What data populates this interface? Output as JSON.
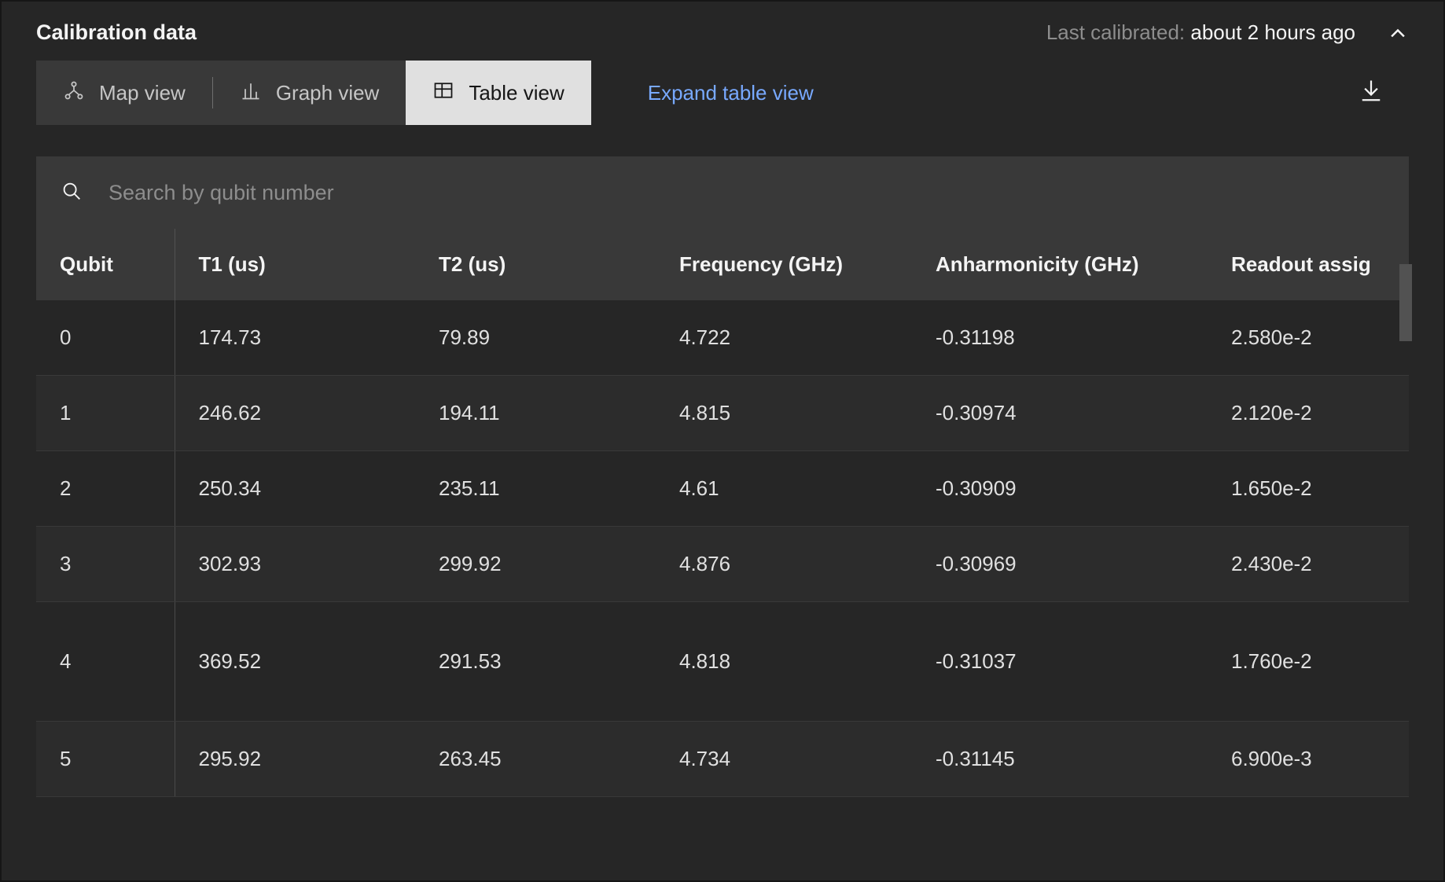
{
  "header": {
    "title": "Calibration data",
    "last_calibrated_label": "Last calibrated: ",
    "last_calibrated_value": "about 2 hours ago"
  },
  "tabs": {
    "map": "Map view",
    "graph": "Graph view",
    "table": "Table view"
  },
  "expand_link": "Expand table view",
  "search": {
    "placeholder": "Search by qubit number"
  },
  "columns": {
    "qubit": "Qubit",
    "t1": "T1 (us)",
    "t2": "T2 (us)",
    "freq": "Frequency (GHz)",
    "anh": "Anharmonicity (GHz)",
    "ro": "Readout assig"
  },
  "rows": [
    {
      "qubit": "0",
      "t1": "174.73",
      "t2": "79.89",
      "freq": "4.722",
      "anh": "-0.31198",
      "ro": "2.580e-2"
    },
    {
      "qubit": "1",
      "t1": "246.62",
      "t2": "194.11",
      "freq": "4.815",
      "anh": "-0.30974",
      "ro": "2.120e-2"
    },
    {
      "qubit": "2",
      "t1": "250.34",
      "t2": "235.11",
      "freq": "4.61",
      "anh": "-0.30909",
      "ro": "1.650e-2"
    },
    {
      "qubit": "3",
      "t1": "302.93",
      "t2": "299.92",
      "freq": "4.876",
      "anh": "-0.30969",
      "ro": "2.430e-2"
    },
    {
      "qubit": "4",
      "t1": "369.52",
      "t2": "291.53",
      "freq": "4.818",
      "anh": "-0.31037",
      "ro": "1.760e-2",
      "tall": true
    },
    {
      "qubit": "5",
      "t1": "295.92",
      "t2": "263.45",
      "freq": "4.734",
      "anh": "-0.31145",
      "ro": "6.900e-3"
    }
  ]
}
